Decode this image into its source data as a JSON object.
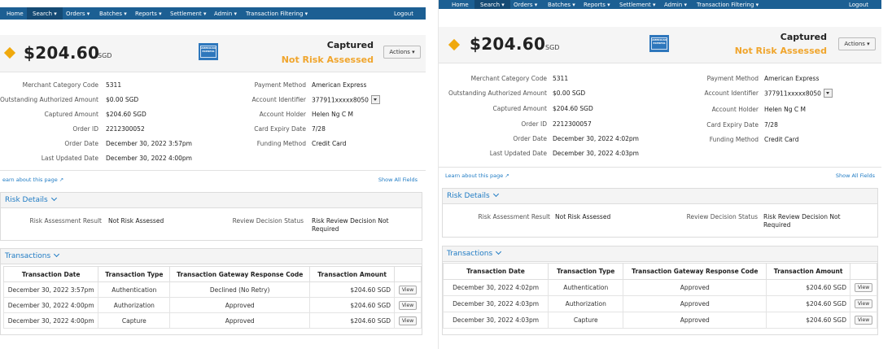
{
  "nav": {
    "items": [
      "Home",
      "Search ▾",
      "Orders ▾",
      "Batches ▾",
      "Reports ▾",
      "Settlement ▾",
      "Admin ▾",
      "Transaction Filtering ▾"
    ],
    "logout": "Logout"
  },
  "colors": {
    "nav_bg": "#1c5f93",
    "accent": "#f0a52c",
    "link": "#1f7bc4"
  },
  "icons": [
    "diamond-status-icon",
    "amex-card-icon",
    "caret-down-icon",
    "external-link-icon",
    "chevron-down-icon"
  ],
  "left": {
    "amount": "$204.60",
    "currency": "SGD",
    "status": "Captured",
    "risk_status": "Not Risk Assessed",
    "actions": "Actions ▾",
    "fields_left": [
      {
        "label": "Merchant Category Code",
        "value": "5311"
      },
      {
        "label": "Outstanding Authorized Amount",
        "value": "$0.00 SGD"
      },
      {
        "label": "Captured Amount",
        "value": "$204.60 SGD"
      },
      {
        "label": "Order ID",
        "value": "2212300052"
      },
      {
        "label": "Order Date",
        "value": "December 30, 2022 3:57pm"
      },
      {
        "label": "Last Updated Date",
        "value": "December 30, 2022 4:00pm"
      }
    ],
    "fields_right": [
      {
        "label": "Payment Method",
        "value": "American Express"
      },
      {
        "label": "Account Identifier",
        "value": "377911xxxxx8050"
      },
      {
        "label": "Account Holder",
        "value": "Helen Ng C M"
      },
      {
        "label": "Card Expiry Date",
        "value": "7/28"
      },
      {
        "label": "Funding Method",
        "value": "Credit Card"
      }
    ],
    "learn_link": "earn about this page ↗",
    "show_all": "Show All Fields",
    "risk_title": "Risk Details",
    "risk_fields": [
      {
        "label": "Risk Assessment Result",
        "value": "Not Risk Assessed"
      },
      {
        "label": "Review Decision Status",
        "value": "Risk Review Decision Not Required"
      }
    ],
    "tx_title": "Transactions",
    "tx_headers": [
      "Transaction Date",
      "Transaction Type",
      "Transaction Gateway Response Code",
      "Transaction Amount"
    ],
    "tx_rows": [
      {
        "date": "December 30, 2022 3:57pm",
        "type": "Authentication",
        "code": "Declined (No Retry)",
        "amount": "$204.60 SGD",
        "action": "View"
      },
      {
        "date": "December 30, 2022 4:00pm",
        "type": "Authorization",
        "code": "Approved",
        "amount": "$204.60 SGD",
        "action": "View"
      },
      {
        "date": "December 30, 2022 4:00pm",
        "type": "Capture",
        "code": "Approved",
        "amount": "$204.60 SGD",
        "action": "View"
      }
    ]
  },
  "right": {
    "amount": "$204.60",
    "currency": "SGD",
    "status": "Captured",
    "risk_status": "Not Risk Assessed",
    "actions": "Actions ▾",
    "fields_left": [
      {
        "label": "Merchant Category Code",
        "value": "5311"
      },
      {
        "label": "Outstanding Authorized Amount",
        "value": "$0.00 SGD"
      },
      {
        "label": "Captured Amount",
        "value": "$204.60 SGD"
      },
      {
        "label": "Order ID",
        "value": "2212300057"
      },
      {
        "label": "Order Date",
        "value": "December 30, 2022 4:02pm"
      },
      {
        "label": "Last Updated Date",
        "value": "December 30, 2022 4:03pm"
      }
    ],
    "fields_right": [
      {
        "label": "Payment Method",
        "value": "American Express"
      },
      {
        "label": "Account Identifier",
        "value": "377911xxxxx8050"
      },
      {
        "label": "Account Holder",
        "value": "Helen Ng C M"
      },
      {
        "label": "Card Expiry Date",
        "value": "7/28"
      },
      {
        "label": "Funding Method",
        "value": "Credit Card"
      }
    ],
    "learn_link": "Learn about this page ↗",
    "show_all": "Show All Fields",
    "risk_title": "Risk Details",
    "risk_fields": [
      {
        "label": "Risk Assessment Result",
        "value": "Not Risk Assessed"
      },
      {
        "label": "Review Decision Status",
        "value": "Risk Review Decision Not Required"
      }
    ],
    "tx_title": "Transactions",
    "tx_headers": [
      "Transaction Date",
      "Transaction Type",
      "Transaction Gateway Response Code",
      "Transaction Amount"
    ],
    "tx_rows": [
      {
        "date": "December 30, 2022 4:02pm",
        "type": "Authentication",
        "code": "Approved",
        "amount": "$204.60 SGD",
        "action": "View"
      },
      {
        "date": "December 30, 2022 4:03pm",
        "type": "Authorization",
        "code": "Approved",
        "amount": "$204.60 SGD",
        "action": "View"
      },
      {
        "date": "December 30, 2022 4:03pm",
        "type": "Capture",
        "code": "Approved",
        "amount": "$204.60 SGD",
        "action": "View"
      }
    ]
  }
}
